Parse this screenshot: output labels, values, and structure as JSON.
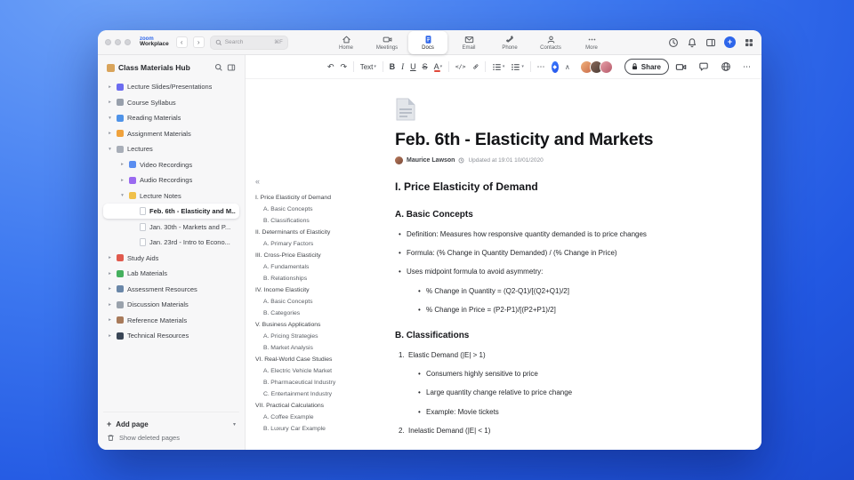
{
  "colors": {
    "accent": "#2E66EA"
  },
  "titlebar": {
    "brand_top": "zoom",
    "brand_bottom": "Workplace",
    "back_icon": "‹",
    "forward_icon": "›",
    "search_placeholder": "Search",
    "search_shortcut": "⌘F",
    "tabs": [
      {
        "name": "home",
        "label": "Home"
      },
      {
        "name": "meetings",
        "label": "Meetings"
      },
      {
        "name": "docs",
        "label": "Docs",
        "state": "active"
      },
      {
        "name": "email",
        "label": "Email"
      },
      {
        "name": "phone",
        "label": "Phone"
      },
      {
        "name": "contacts",
        "label": "Contacts"
      },
      {
        "name": "more",
        "label": "More"
      }
    ]
  },
  "sidebar": {
    "title": "Class Materials Hub",
    "items": [
      {
        "label": "Lecture Slides/Presentations",
        "icon": "slides-icon",
        "icon_style": "--c:#6c6cf0",
        "chevron": "▸",
        "level": 1
      },
      {
        "label": "Course Syllabus",
        "icon": "syllabus-icon",
        "icon_style": "--c:#98a0ac",
        "chevron": "▸",
        "level": 1
      },
      {
        "label": "Reading Materials",
        "icon": "book-icon",
        "icon_style": "--c:#4f93e8",
        "chevron": "▾",
        "level": 1
      },
      {
        "label": "Assignment Materials",
        "icon": "assignment-icon",
        "icon_style": "--c:#f0a23c",
        "chevron": "▸",
        "level": 1
      },
      {
        "label": "Lectures",
        "icon": "lectures-icon",
        "icon_style": "--c:#a8aeb8",
        "chevron": "▾",
        "level": 1
      },
      {
        "label": "Video Recordings",
        "icon": "video-icon",
        "icon_style": "--c:#5a8df0",
        "chevron": "▸",
        "level": 2
      },
      {
        "label": "Audio Recordings",
        "icon": "audio-icon",
        "icon_style": "--c:#9a6af0",
        "chevron": "▸",
        "level": 2
      },
      {
        "label": "Lecture Notes",
        "icon": "notes-icon",
        "icon_style": "--c:#f0c04a",
        "chevron": "▾",
        "level": 2
      },
      {
        "label": "Feb. 6th - Elasticity and M...",
        "icon": "page-icon",
        "icon_style": "--c:#ffffff",
        "chevron": "",
        "level": 3,
        "state": "selected"
      },
      {
        "label": "Jan. 30th - Markets and P...",
        "icon": "page-icon",
        "icon_style": "--c:#ffffff",
        "chevron": "",
        "level": 3
      },
      {
        "label": "Jan. 23rd - Intro to Econo...",
        "icon": "page-icon",
        "icon_style": "--c:#ffffff",
        "chevron": "",
        "level": 3
      },
      {
        "label": "Study Aids",
        "icon": "apple-icon",
        "icon_style": "--c:#e05a4e",
        "chevron": "▸",
        "level": 1
      },
      {
        "label": "Lab Materials",
        "icon": "lab-icon",
        "icon_style": "--c:#45b05e",
        "chevron": "▸",
        "level": 1
      },
      {
        "label": "Assessment Resources",
        "icon": "assessment-icon",
        "icon_style": "--c:#6a87a8",
        "chevron": "▸",
        "level": 1
      },
      {
        "label": "Discussion Materials",
        "icon": "discussion-icon",
        "icon_style": "--c:#9aa2ac",
        "chevron": "▸",
        "level": 1
      },
      {
        "label": "Reference Materials",
        "icon": "reference-icon",
        "icon_style": "--c:#a87a5a",
        "chevron": "▸",
        "level": 1
      },
      {
        "label": "Technical Resources",
        "icon": "tech-icon",
        "icon_style": "--c:#3a4656",
        "chevron": "▸",
        "level": 1
      }
    ],
    "add_page": {
      "plus": "+",
      "label": "Add page",
      "chevron": "▾"
    },
    "deleted": {
      "label": "Show deleted pages"
    }
  },
  "toolbar": {
    "undo": "↶",
    "redo": "↷",
    "text_style": "Text",
    "dropdown": "▾",
    "bold": "B",
    "italic": "I",
    "underline": "U",
    "strike": "S",
    "color": "A",
    "code": "</>",
    "more": "⋯",
    "ai": "◆",
    "caret": "∧",
    "share": "Share"
  },
  "doc": {
    "title": "Feb. 6th - Elasticity and Markets",
    "author": "Maurice Lawson",
    "updated": "Updated at 19:01 10/01/2020",
    "outline_collapse": "«",
    "outline": [
      {
        "label": "I. Price Elasticity of Demand",
        "level": 1
      },
      {
        "label": "A. Basic Concepts",
        "level": 2
      },
      {
        "label": "B. Classifications",
        "level": 2
      },
      {
        "label": "II. Determinants of Elasticity",
        "level": 1
      },
      {
        "label": "A. Primary Factors",
        "level": 2
      },
      {
        "label": "III. Cross-Price Elasticity",
        "level": 1
      },
      {
        "label": "A. Fundamentals",
        "level": 2
      },
      {
        "label": "B. Relationships",
        "level": 2
      },
      {
        "label": "IV. Income Elasticity",
        "level": 1
      },
      {
        "label": "A. Basic Concepts",
        "level": 2
      },
      {
        "label": "B. Categories",
        "level": 2
      },
      {
        "label": "V. Business Applications",
        "level": 1
      },
      {
        "label": "A. Pricing Strategies",
        "level": 2
      },
      {
        "label": "B. Market Analysis",
        "level": 2
      },
      {
        "label": "VI. Real-World Case Studies",
        "level": 1
      },
      {
        "label": "A. Electric Vehicle Market",
        "level": 2
      },
      {
        "label": "B. Pharmaceutical Industry",
        "level": 2
      },
      {
        "label": "C. Entertainment Industry",
        "level": 2
      },
      {
        "label": "VII. Practical Calculations",
        "level": 1
      },
      {
        "label": "A. Coffee Example",
        "level": 2
      },
      {
        "label": "B. Luxury Car Example",
        "level": 2
      }
    ],
    "blocks": [
      {
        "type": "h2",
        "marker": "",
        "text": "I. Price Elasticity of Demand"
      },
      {
        "type": "h3",
        "marker": "",
        "text": "A. Basic Concepts"
      },
      {
        "type": "b1",
        "marker": "•",
        "text": "Definition: Measures how responsive quantity demanded is to price changes"
      },
      {
        "type": "b1",
        "marker": "•",
        "text": "Formula: (% Change in Quantity Demanded) / (% Change in Price)"
      },
      {
        "type": "b1",
        "marker": "•",
        "text": "Uses midpoint formula to avoid asymmetry:"
      },
      {
        "type": "b2",
        "marker": "•",
        "text": "% Change in Quantity = (Q2-Q1)/[(Q2+Q1)/2]"
      },
      {
        "type": "b2",
        "marker": "•",
        "text": "% Change in Price = (P2-P1)/[(P2+P1)/2]"
      },
      {
        "type": "h3",
        "marker": "",
        "text": "B. Classifications"
      },
      {
        "type": "n1",
        "marker": "1.",
        "text": "Elastic Demand (|E| > 1)"
      },
      {
        "type": "b2",
        "marker": "•",
        "text": "Consumers highly sensitive to price"
      },
      {
        "type": "b2",
        "marker": "•",
        "text": "Large quantity change relative to price change"
      },
      {
        "type": "b2",
        "marker": "•",
        "text": "Example: Movie tickets"
      },
      {
        "type": "n1",
        "marker": "2.",
        "text": "Inelastic Demand (|E| < 1)"
      }
    ]
  }
}
